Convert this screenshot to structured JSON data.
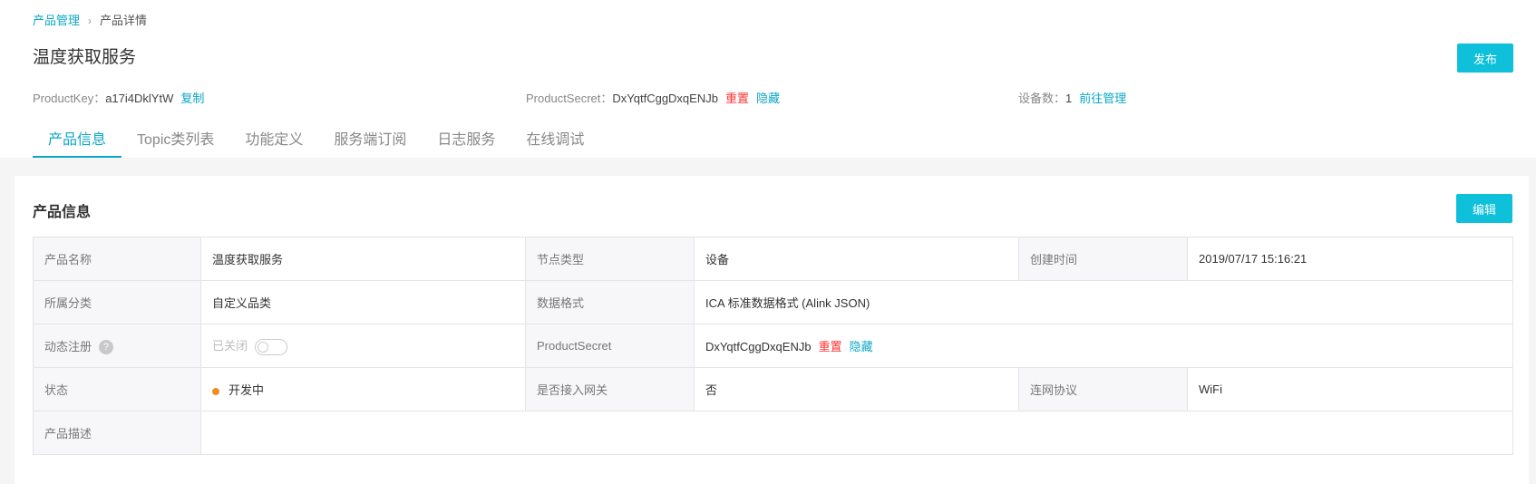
{
  "breadcrumb": {
    "parent": "产品管理",
    "sep": "›",
    "current": "产品详情"
  },
  "title": "温度获取服务",
  "publish_label": "发布",
  "meta": {
    "productkey_label": "ProductKey：",
    "productkey_value": "a17i4DklYtW",
    "copy_label": "复制",
    "secret_label": "ProductSecret：",
    "secret_value": "DxYqtfCggDxqENJb",
    "reset_label": "重置",
    "hide_label": "隐藏",
    "devices_label": "设备数：",
    "devices_value": "1",
    "manage_label": "前往管理"
  },
  "tabs": [
    "产品信息",
    "Topic类列表",
    "功能定义",
    "服务端订阅",
    "日志服务",
    "在线调试"
  ],
  "card": {
    "title": "产品信息",
    "edit_label": "编辑"
  },
  "info": {
    "name_label": "产品名称",
    "name_value": "温度获取服务",
    "node_label": "节点类型",
    "node_value": "设备",
    "created_label": "创建时间",
    "created_value": "2019/07/17 15:16:21",
    "category_label": "所属分类",
    "category_value": "自定义品类",
    "format_label": "数据格式",
    "format_value": "ICA 标准数据格式 (Alink JSON)",
    "dynreg_label": "动态注册",
    "help_glyph": "?",
    "dynreg_value": "已关闭",
    "secret_label": "ProductSecret",
    "secret_value": "DxYqtfCggDxqENJb",
    "status_label": "状态",
    "status_value": "开发中",
    "gateway_label": "是否接入网关",
    "gateway_value": "否",
    "protocol_label": "连网协议",
    "protocol_value": "WiFi",
    "desc_label": "产品描述",
    "desc_value": ""
  },
  "colors": {
    "accent": "#0ec0d9",
    "link": "#0aa7c5",
    "danger": "#ff3333",
    "status_dot": "#f68b1f"
  }
}
